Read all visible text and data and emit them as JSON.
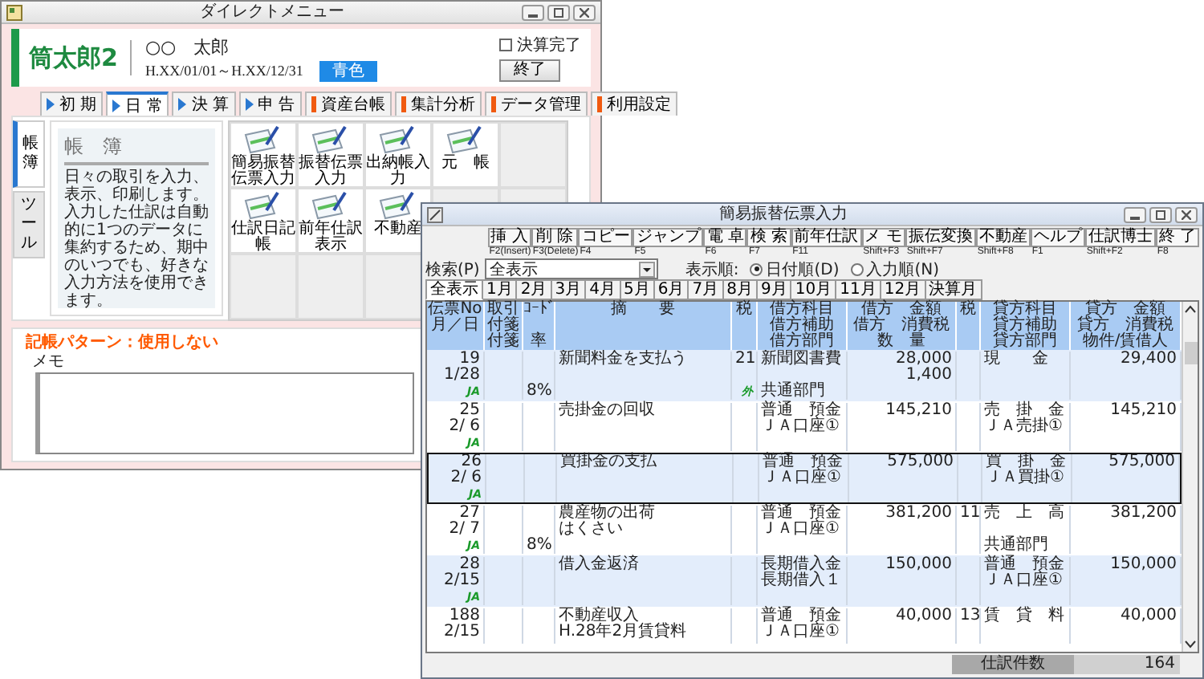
{
  "menu_window": {
    "title": "ダイレクトメニュー",
    "logo": "筒太郎2",
    "user_name": "○○　太郎",
    "period": "H.XX/01/01～H.XX/12/31",
    "filing_type": "青色",
    "closing_done": {
      "label": "決算完了",
      "checked": false
    },
    "exit_button": "終了",
    "tabs": [
      {
        "label": "初 期",
        "kind": "arrow",
        "selected": false
      },
      {
        "label": "日 常",
        "kind": "arrow",
        "selected": true
      },
      {
        "label": "決 算",
        "kind": "arrow",
        "selected": false
      },
      {
        "label": "申 告",
        "kind": "arrow",
        "selected": false
      },
      {
        "label": "資産台帳",
        "kind": "bar",
        "selected": false
      },
      {
        "label": "集計分析",
        "kind": "bar",
        "selected": false
      },
      {
        "label": "データ管理",
        "kind": "bar",
        "selected": false
      },
      {
        "label": "利用設定",
        "kind": "bar",
        "selected": false
      }
    ],
    "side_tabs": [
      {
        "label": "帳簿",
        "selected": true
      },
      {
        "label": "ツール",
        "selected": false
      }
    ],
    "panel": {
      "title": "帳　簿",
      "description": "日々の取引を入力、表示、印刷します。入力した仕訳は自動的に1つのデータに集約するため、期中のいつでも、好きな入力方法を使用できます。"
    },
    "launcher_rows": [
      [
        "簡易振替伝票入力",
        "振替伝票入力",
        "出納帳入力",
        "元　帳"
      ],
      [
        "仕訳日記帳",
        "前年仕訳表示",
        "不動産"
      ]
    ],
    "pattern_status": "記帳パターン：使用しない",
    "memo": {
      "label": "メモ"
    }
  },
  "entry_window": {
    "title": "簡易振替伝票入力",
    "toolbar": [
      {
        "label": "挿 入",
        "key": "F2(Insert)"
      },
      {
        "label": "削 除",
        "key": "F3(Delete)"
      },
      {
        "label": "コピー",
        "key": "F4"
      },
      {
        "label": "ジャンプ",
        "key": "F5"
      },
      {
        "label": "電 卓",
        "key": "F6"
      },
      {
        "label": "検 索",
        "key": "F7"
      },
      {
        "label": "前年仕訳",
        "key": "F11"
      },
      {
        "label": "メ モ",
        "key": "Shift+F3"
      },
      {
        "label": "振伝変換",
        "key": "Shift+F7"
      },
      {
        "label": "不動産",
        "key": "Shift+F8"
      },
      {
        "label": "ヘルプ",
        "key": "F1"
      },
      {
        "label": "仕訳博士",
        "key": "Shift+F2"
      },
      {
        "label": "終 了",
        "key": "F8"
      }
    ],
    "search": {
      "label": "検索(P)",
      "value": "全表示"
    },
    "sort_order": {
      "label": "表示順:",
      "options": [
        {
          "label": "日付順(D)",
          "selected": true
        },
        {
          "label": "入力順(N)",
          "selected": false
        }
      ]
    },
    "month_tabs": [
      {
        "label": "全表示",
        "selected": true
      },
      {
        "label": "1月",
        "selected": false
      },
      {
        "label": "2月",
        "selected": false
      },
      {
        "label": "3月",
        "selected": false
      },
      {
        "label": "4月",
        "selected": false
      },
      {
        "label": "5月",
        "selected": false
      },
      {
        "label": "6月",
        "selected": false
      },
      {
        "label": "7月",
        "selected": false
      },
      {
        "label": "8月",
        "selected": false
      },
      {
        "label": "9月",
        "selected": false
      },
      {
        "label": "10月",
        "selected": false
      },
      {
        "label": "11月",
        "selected": false
      },
      {
        "label": "12月",
        "selected": false
      },
      {
        "label": "決算月",
        "selected": false
      }
    ],
    "columns": [
      {
        "line_1": "伝票No",
        "line_2": "月／日"
      },
      {
        "line_1": "取引",
        "line_2": "付箋",
        "line_3": "付箋"
      },
      {
        "line_1": "ｺｰﾄﾞ",
        "line_3": "率"
      },
      {
        "line_1": "摘　　要"
      },
      {
        "line_1": "税"
      },
      {
        "line_1": "借方科目",
        "line_2": "借方補助",
        "line_3": "借方部門"
      },
      {
        "line_1": "借方　金額",
        "line_2": "借方　消費税",
        "line_3": "数　量"
      },
      {
        "line_1": "税"
      },
      {
        "line_1": "貸方科目",
        "line_2": "貸方補助",
        "line_3": "貸方部門"
      },
      {
        "line_1": "貸方　金額",
        "line_2": "貸方　消費税",
        "line_3": "物件/賃借人"
      }
    ],
    "entries": [
      {
        "no": "19",
        "date": "1/28",
        "ja_mark": "JA",
        "rate": "8%",
        "summary": "新聞料金を支払う",
        "tax_code": "21",
        "tax_mark": "外",
        "debit_account": "新聞図書費",
        "debit_dept": "共通部門",
        "debit_amount": "28,000",
        "debit_tax": "1,400",
        "credit_account": "現　　金",
        "credit_amount": "29,400",
        "selected": false
      },
      {
        "no": "25",
        "date": "2/ 6",
        "ja_mark": "JA",
        "summary": "売掛金の回収",
        "debit_account": "普通　預金",
        "debit_sub": "ＪＡ口座①",
        "debit_amount": "145,210",
        "credit_account": "売　掛　金",
        "credit_sub": "ＪＡ売掛①",
        "credit_amount": "145,210",
        "selected": false
      },
      {
        "no": "26",
        "date": "2/ 6",
        "ja_mark": "JA",
        "summary": "買掛金の支払",
        "debit_account": "普通　預金",
        "debit_sub": "ＪＡ口座①",
        "debit_amount": "575,000",
        "credit_account": "買　掛　金",
        "credit_sub": "ＪＡ買掛①",
        "credit_amount": "575,000",
        "selected": true
      },
      {
        "no": "27",
        "date": "2/ 7",
        "ja_mark": "JA",
        "rate": "8%",
        "summary": "農産物の出荷",
        "summary_2": "はくさい",
        "debit_account": "普通　預金",
        "debit_sub": "ＪＡ口座①",
        "debit_amount": "381,200",
        "credit_tax_code": "11",
        "credit_account": "売　上　高",
        "credit_dept": "共通部門",
        "credit_amount": "381,200",
        "selected": false
      },
      {
        "no": "28",
        "date": "2/15",
        "ja_mark": "JA",
        "summary": "借入金返済",
        "debit_account": "長期借入金",
        "debit_sub": "長期借入１",
        "debit_amount": "150,000",
        "credit_account": "普通　預金",
        "credit_sub": "ＪＡ口座①",
        "credit_amount": "150,000",
        "selected": false
      },
      {
        "no": "188",
        "date": "2/15",
        "summary": "不動産収入",
        "summary_2": "H.28年2月賃貸料",
        "debit_account": "普通　預金",
        "debit_sub": "ＪＡ口座①",
        "debit_amount": "40,000",
        "credit_tax_code": "13",
        "credit_account": "賃　貸　料",
        "credit_amount": "40,000",
        "selected": false
      }
    ],
    "footer": {
      "label": "仕訳件数",
      "value": "164"
    }
  }
}
